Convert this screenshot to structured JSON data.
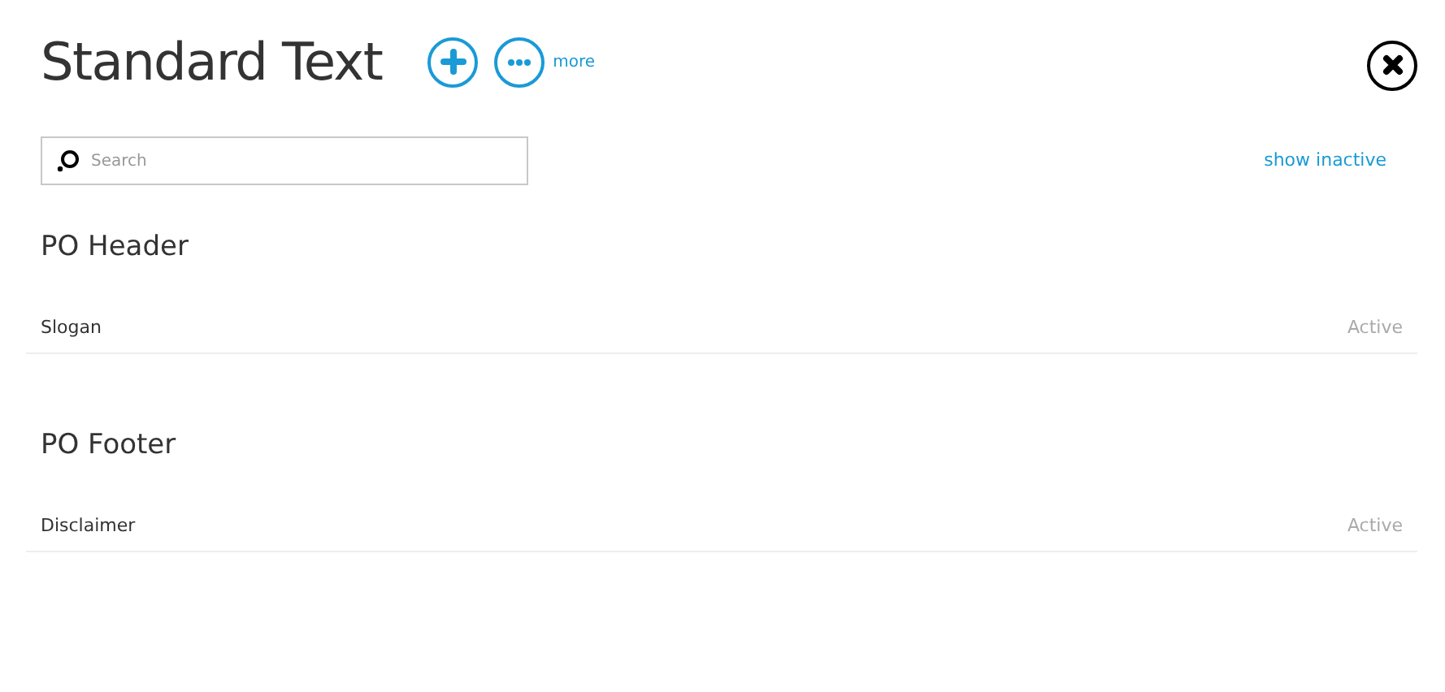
{
  "page": {
    "title": "Standard Text",
    "more_label": "more"
  },
  "search": {
    "placeholder": "Search"
  },
  "show_inactive": "show inactive",
  "groups": [
    {
      "title": "PO Header",
      "items": [
        {
          "name": "Slogan",
          "status": "Active"
        }
      ]
    },
    {
      "title": "PO Footer",
      "items": [
        {
          "name": "Disclaimer",
          "status": "Active"
        }
      ]
    }
  ]
}
